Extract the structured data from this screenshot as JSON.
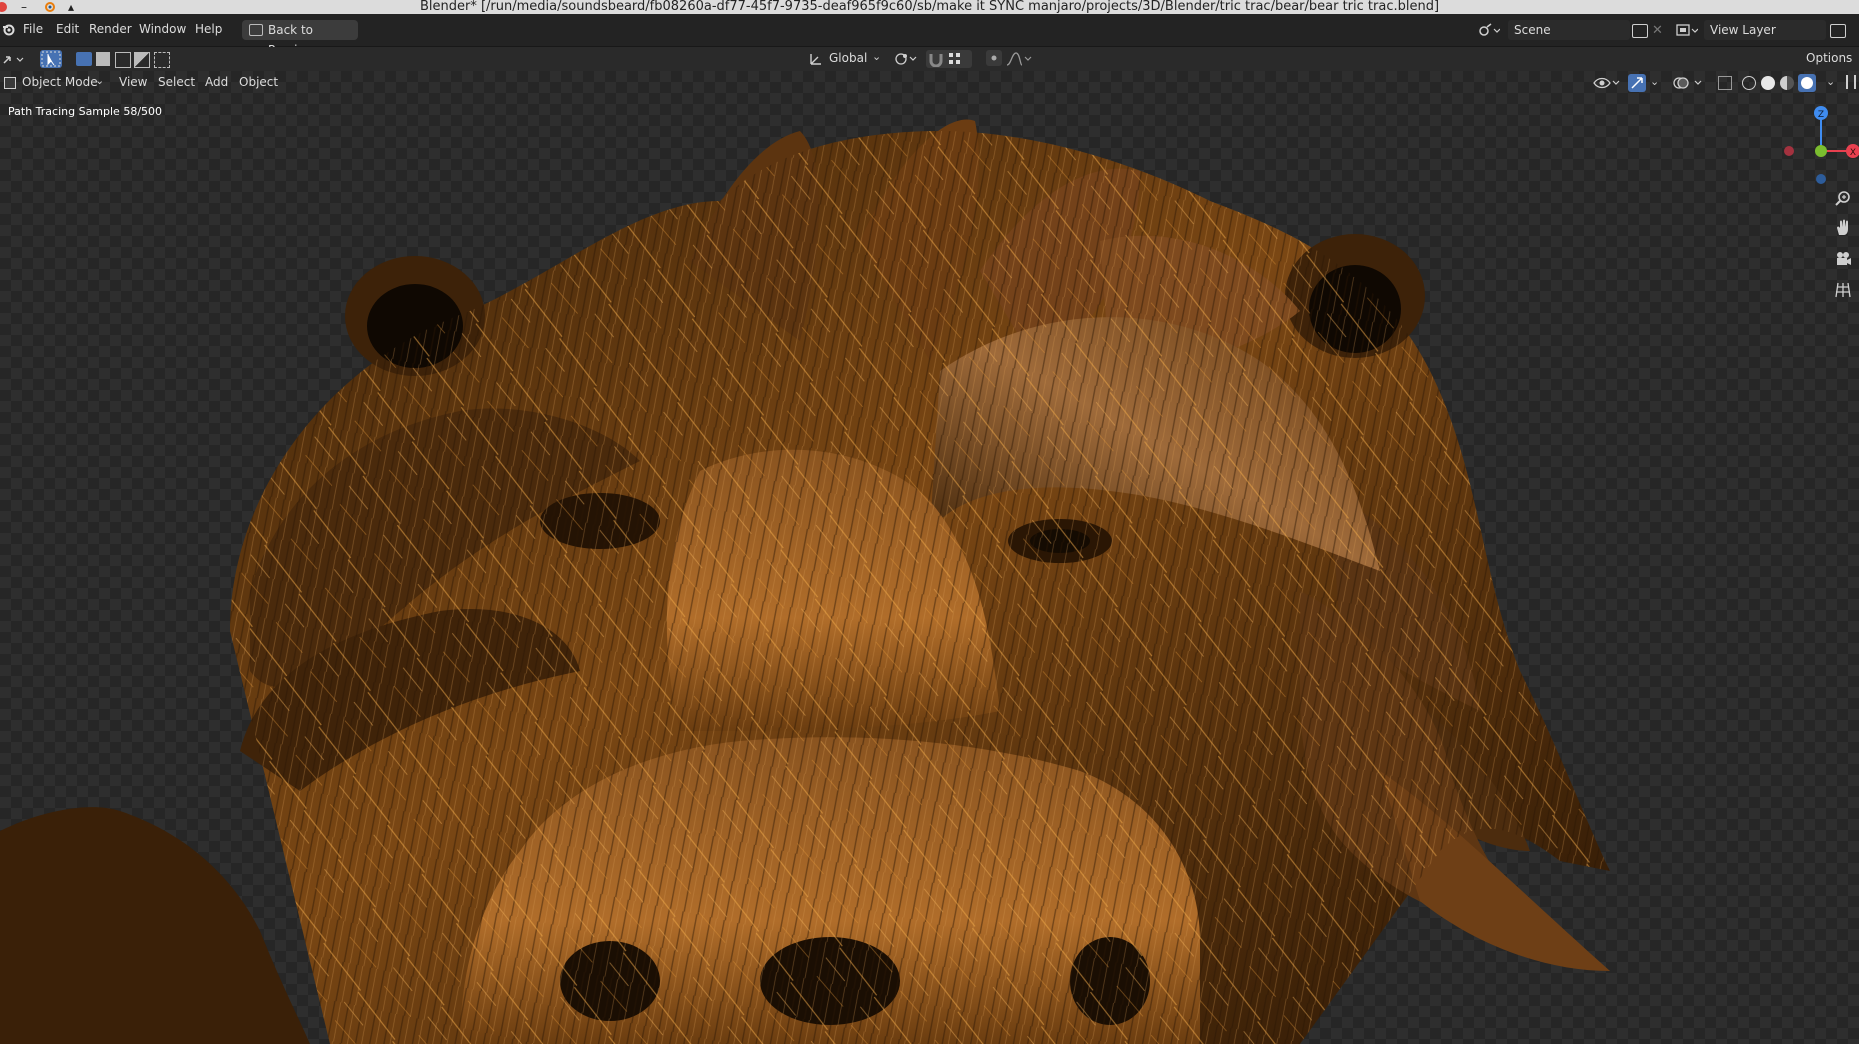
{
  "window": {
    "title": "Blender* [/run/media/soundsbeard/fb08260a-df77-45f7-9735-deaf965f9c60/sb/make it SYNC manjaro/projects/3D/Blender/tric trac/bear/bear tric trac.blend]",
    "minimize_glyph": "–",
    "maximize_glyph": "▴"
  },
  "menubar": {
    "items": [
      "File",
      "Edit",
      "Render",
      "Window",
      "Help"
    ],
    "back_button": "Back to Previous",
    "scene": "Scene",
    "view_layer": "View Layer"
  },
  "tool_header": {
    "orientation": "Global",
    "options": "Options"
  },
  "viewport": {
    "mode": "Object Mode",
    "menus": [
      "View",
      "Select",
      "Add",
      "Object"
    ],
    "render_status": "Path Tracing Sample 58/500",
    "gizmo": {
      "z_label": "Z",
      "x_label": "X",
      "colors": {
        "x": "#e8404f",
        "y": "#7bbd2f",
        "z": "#3f8cf0"
      }
    }
  },
  "icons": [
    "blender-logo-icon",
    "editor-type-icon",
    "select-box-icon",
    "transform-orientation-icon",
    "snap-icon",
    "proportional-edit-icon",
    "viewport-shading-icons",
    "zoom-icon",
    "pan-hand-icon",
    "camera-icon",
    "grid-icon"
  ]
}
